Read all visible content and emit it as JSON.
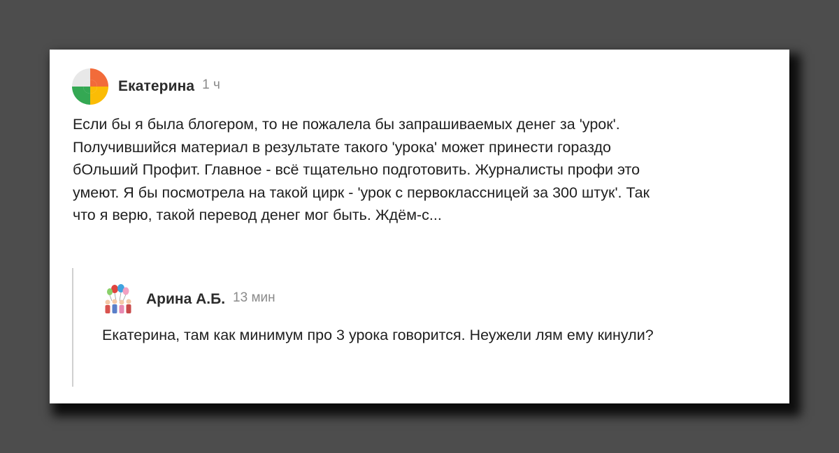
{
  "comment": {
    "author": "Екатерина",
    "time": "1 ч",
    "lines": [
      "Если бы я была блогером, то не пожалела бы запрашиваемых денег за 'урок'.",
      "Получившийся материал в результате такого 'урока' может принести гораздо",
      "бОльший Профит. Главное - всё тщательно подготовить. Журналисты профи это",
      "умеют. Я бы посмотрела на такой цирк - 'урок с первоклассницей за 300 штук'. Так",
      "что я верю, такой перевод денег мог быть. Ждём-с..."
    ],
    "avatar_icon": "four-color-pinwheel-icon",
    "avatar_colors": [
      "#34a853",
      "#e8e8e8",
      "#f26b3a",
      "#fbbc05"
    ]
  },
  "reply": {
    "author": "Арина А.Б.",
    "time": "13 мин",
    "text": "Екатерина, там как минимум про 3 урока говорится. Неужели лям ему кинули?",
    "avatar_icon": "people-with-balloons-icon"
  }
}
